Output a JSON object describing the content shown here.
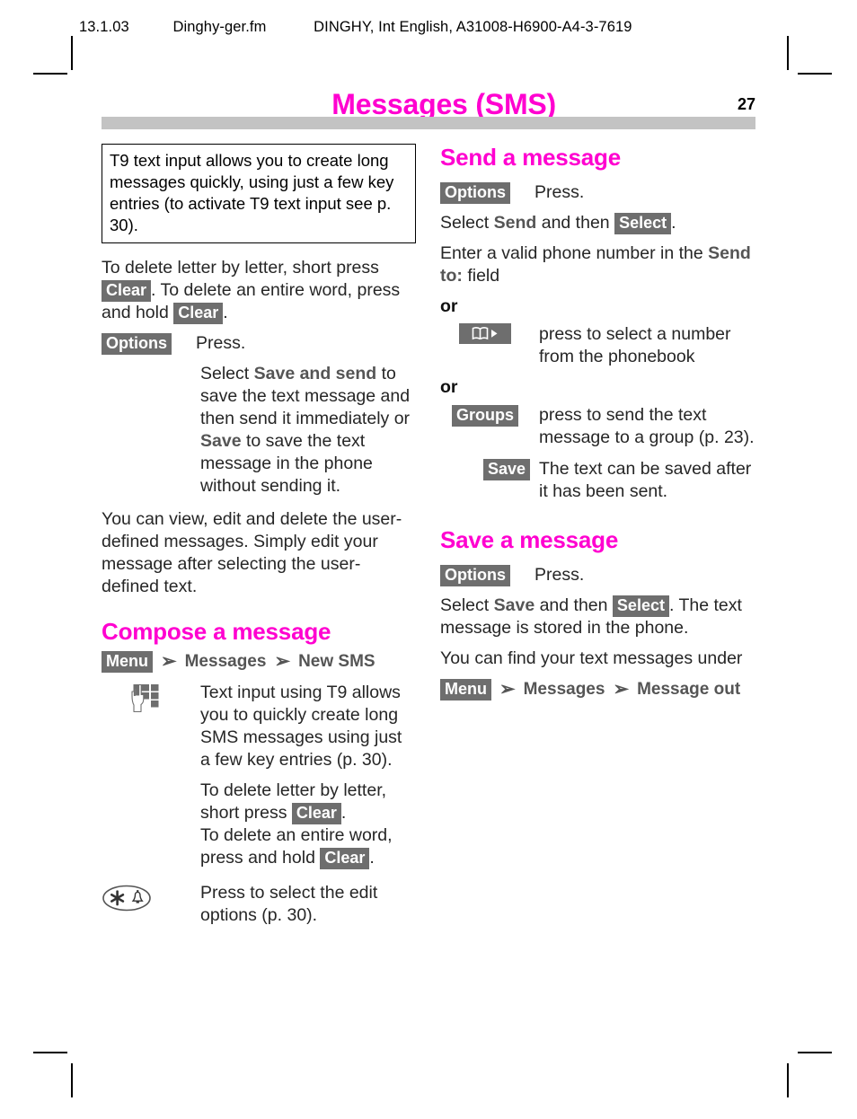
{
  "header": {
    "date": "13.1.03",
    "file": "Dinghy-ger.fm",
    "reference": "DINGHY, Int English, A31008-H6900-A4-3-7619"
  },
  "page": {
    "title": "Messages (SMS)",
    "number": "27",
    "title_color": "#ff00d0",
    "rule_color": "#c3c3c3"
  },
  "left_column": {
    "note_box": "T9 text input allows you to create long messages quickly, using just a few key entries (to activate T9 text input see p. 30).",
    "delete_para": {
      "part1": "To delete letter by letter, short press ",
      "key1": "Clear",
      "part2": ". To delete an entire word, press and hold ",
      "key2": "Clear",
      "part3": "."
    },
    "options_row": {
      "key": "Options",
      "text": "Press."
    },
    "save_and_send_para": {
      "part1": "Select ",
      "bold1": "Save and send",
      "part2": " to save the text message and then send it immediately or ",
      "bold2": "Save",
      "part3": " to save the text message in the phone without sending it."
    },
    "user_defined_para": "You can view, edit and delete the user-defined messages. Simply edit your message after selecting the user-defined text.",
    "compose_heading": "Compose a message",
    "compose_breadcrumb": [
      "Menu",
      "Messages",
      "New SMS"
    ],
    "keypad_row": {
      "icon": "keypad-hand-icon",
      "text": "Text input using T9 allows you to quickly create long SMS messages using just a few key entries (p. 30)."
    },
    "clear_row": {
      "part1": "To delete letter by letter, short press ",
      "key1": "Clear",
      "part2": ".",
      "part3": "To delete an entire word, press and hold ",
      "key2": "Clear",
      "part4": "."
    },
    "star_row": {
      "icon": "star-key-icon",
      "text": "Press to select the edit options (p. 30)."
    }
  },
  "right_column": {
    "send_heading": "Send a message",
    "options_row": {
      "key": "Options",
      "text": "Press."
    },
    "select_send_para": {
      "part1": "Select ",
      "bold1": "Send",
      "part2": " and then ",
      "key1": "Select",
      "part3": "."
    },
    "enter_number_para": {
      "part1": "Enter a valid phone number in the ",
      "bold1": "Send to:",
      "part2": " field"
    },
    "or_label_1": "or",
    "phonebook_row": {
      "icon": "phonebook-icon",
      "text": "press to select a number from the phonebook"
    },
    "or_label_2": "or",
    "groups_row": {
      "key": "Groups",
      "text": "press to send the text message to a group (p. 23)."
    },
    "save_row": {
      "key": "Save",
      "text": "The text can be saved after it has been sent."
    },
    "save_heading": "Save a message",
    "save_options_row": {
      "key": "Options",
      "text": "Press."
    },
    "select_save_para": {
      "part1": "Select ",
      "bold1": "Save",
      "part2": " and then ",
      "key1": "Select",
      "part3": ". The text message is stored in the phone."
    },
    "find_para": "You can find your text messages under",
    "find_breadcrumb": [
      "Menu",
      "Messages",
      "Message out"
    ]
  }
}
